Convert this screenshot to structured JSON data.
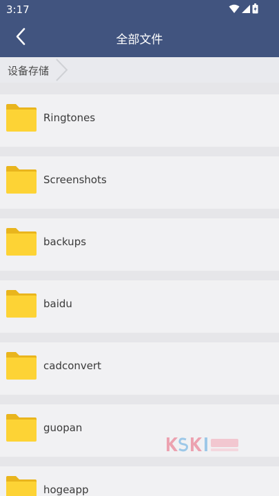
{
  "status_bar": {
    "time": "3:17",
    "icons": [
      "wifi-icon",
      "signal-icon",
      "battery-icon"
    ]
  },
  "app_bar": {
    "title": "全部文件",
    "back_icon": "back-arrow-icon"
  },
  "breadcrumb": {
    "items": [
      "设备存储"
    ]
  },
  "files": [
    {
      "name": "Ringtones",
      "icon": "folder-icon"
    },
    {
      "name": "Screenshots",
      "icon": "folder-icon"
    },
    {
      "name": "backups",
      "icon": "folder-icon"
    },
    {
      "name": "baidu",
      "icon": "folder-icon"
    },
    {
      "name": "cadconvert",
      "icon": "folder-icon"
    },
    {
      "name": "guopan",
      "icon": "folder-icon"
    },
    {
      "name": "hogeapp",
      "icon": "folder-icon"
    }
  ],
  "colors": {
    "header_bg": "#41547f",
    "folder": "#fdd335",
    "folder_tab": "#e9b51d",
    "list_bg": "#e6e6e9",
    "row_bg": "#f1f1f3"
  }
}
